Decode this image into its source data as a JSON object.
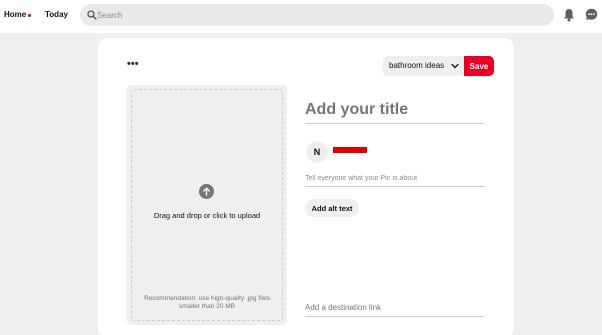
{
  "header": {
    "nav_home": "Home",
    "nav_today": "Today",
    "search_placeholder": "Search",
    "search_icon": "search-icon",
    "notifications_icon": "bell-icon",
    "messages_icon": "chat-icon",
    "home_dot_color": "#e60023"
  },
  "pin_form": {
    "more_options_label": "•••",
    "board_select": {
      "selected": "bathroom ideas"
    },
    "save_label": "Save",
    "upload": {
      "instruction": "Drag and drop or click to upload",
      "recommendation": "Recommendation: use high-quality .jpg files smaller than 20 MB"
    },
    "title_placeholder": "Add your title",
    "avatar_initial": "N",
    "description_placeholder": "Tell everyone what your Pin is about",
    "alt_text_label": "Add alt text",
    "destination_placeholder": "Add a destination link"
  },
  "colors": {
    "accent": "#e60023",
    "background": "#efefef",
    "card": "#ffffff"
  }
}
